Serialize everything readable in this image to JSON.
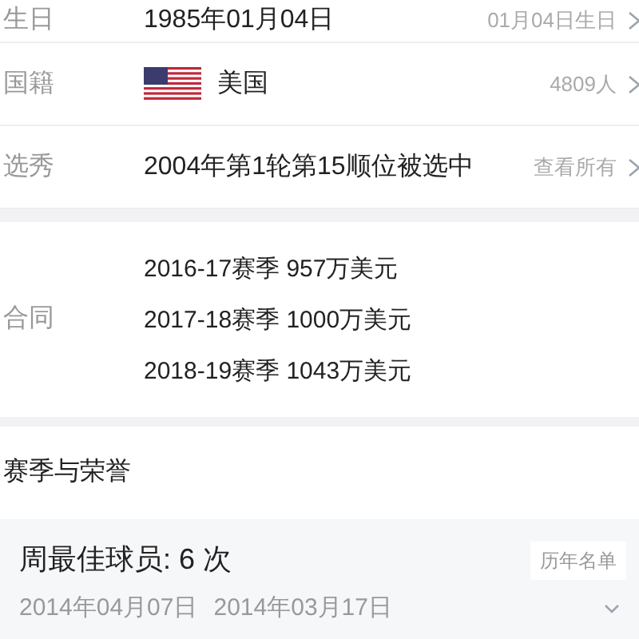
{
  "info_rows": [
    {
      "label": "生日",
      "value": "1985年01月04日",
      "extra": "01月04日生日",
      "kind": "text"
    },
    {
      "label": "国籍",
      "value": "美国",
      "extra": "4809人",
      "kind": "flag"
    },
    {
      "label": "选秀",
      "value": "2004年第1轮第15顺位被选中",
      "extra": "查看所有",
      "kind": "text"
    }
  ],
  "contract": {
    "label": "合同",
    "lines": [
      "2016-17赛季 957万美元",
      "2017-18赛季 1000万美元",
      "2018-19赛季 1043万美元"
    ]
  },
  "honors": {
    "title": "赛季与荣誉",
    "award": "周最佳球员: 6 次",
    "button": "历年名单",
    "dates": [
      "2014年04月07日",
      "2014年03月17日"
    ],
    "expanded": false
  }
}
